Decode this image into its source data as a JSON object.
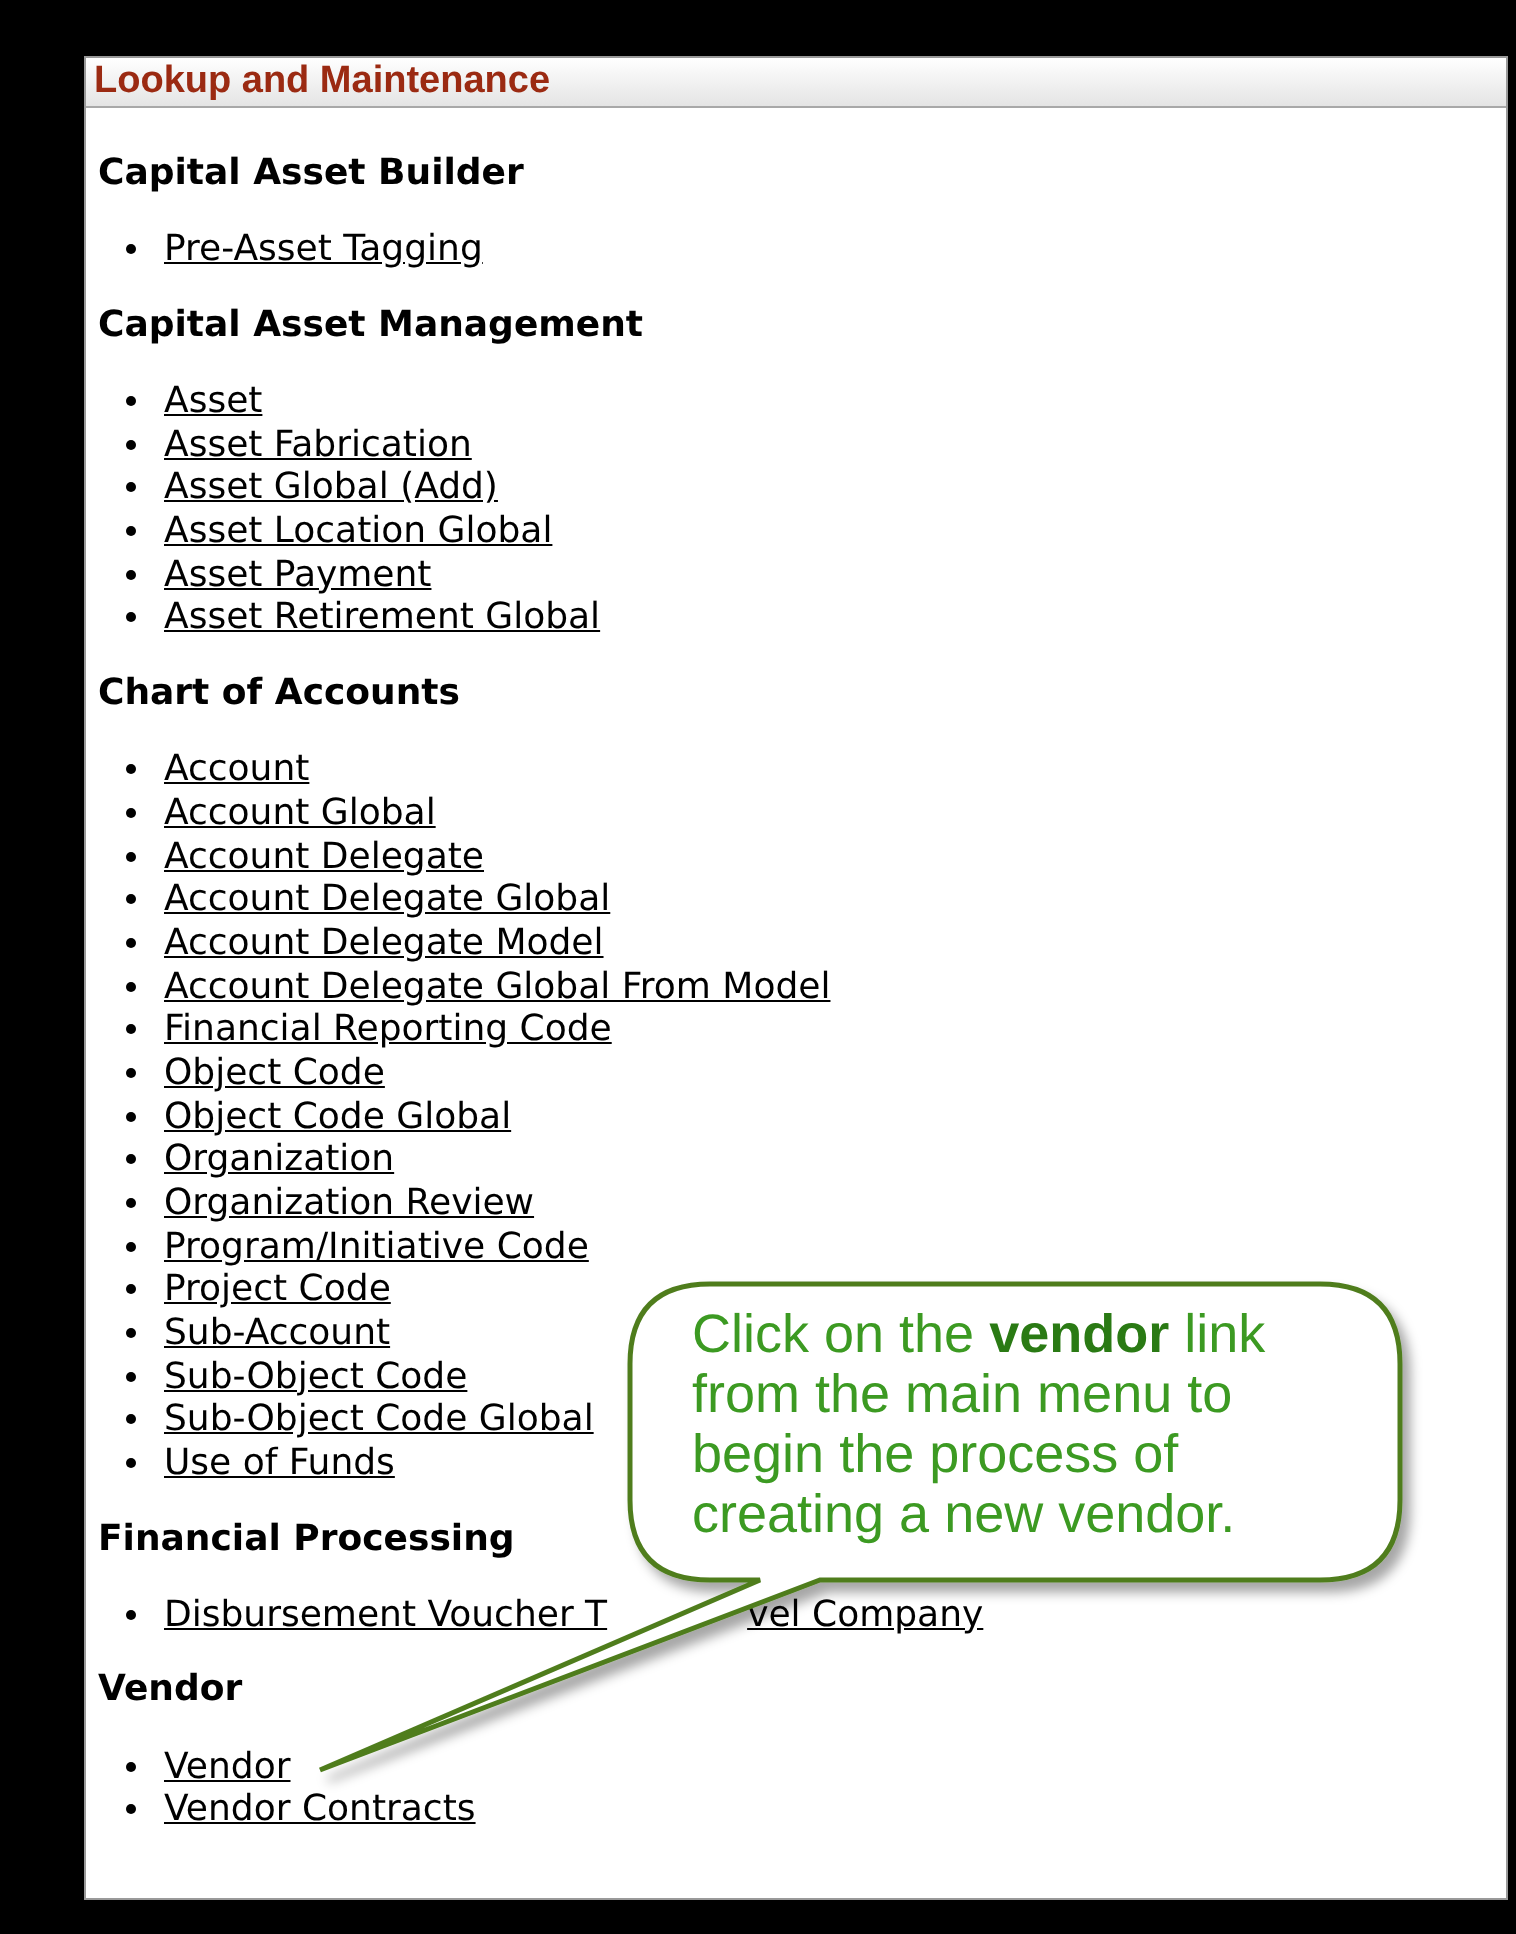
{
  "panel": {
    "title": "Lookup and Maintenance"
  },
  "sections": [
    {
      "title": "Capital Asset Builder",
      "links": [
        "Pre-Asset Tagging"
      ]
    },
    {
      "title": "Capital Asset Management",
      "links": [
        "Asset",
        "Asset Fabrication",
        "Asset Global (Add)",
        "Asset Location Global",
        "Asset Payment",
        "Asset Retirement Global"
      ]
    },
    {
      "title": "Chart of Accounts",
      "links": [
        "Account",
        "Account Global",
        "Account Delegate",
        "Account Delegate Global",
        "Account Delegate Model",
        "Account Delegate Global From Model",
        "Financial Reporting Code",
        "Object Code",
        "Object Code Global",
        "Organization",
        "Organization Review",
        "Program/Initiative Code",
        "Project Code",
        "Sub-Account",
        "Sub-Object Code",
        "Sub-Object Code Global",
        "Use of Funds"
      ]
    },
    {
      "title": "Financial Processing",
      "links": [
        [
          "Disbursement Voucher T",
          "vel Company"
        ]
      ]
    },
    {
      "title": "Vendor",
      "links": [
        "Vendor",
        "Vendor Contracts"
      ]
    }
  ],
  "callout": {
    "text": "Click on the **vendor** link from the main menu to begin the process of creating a new vendor."
  }
}
